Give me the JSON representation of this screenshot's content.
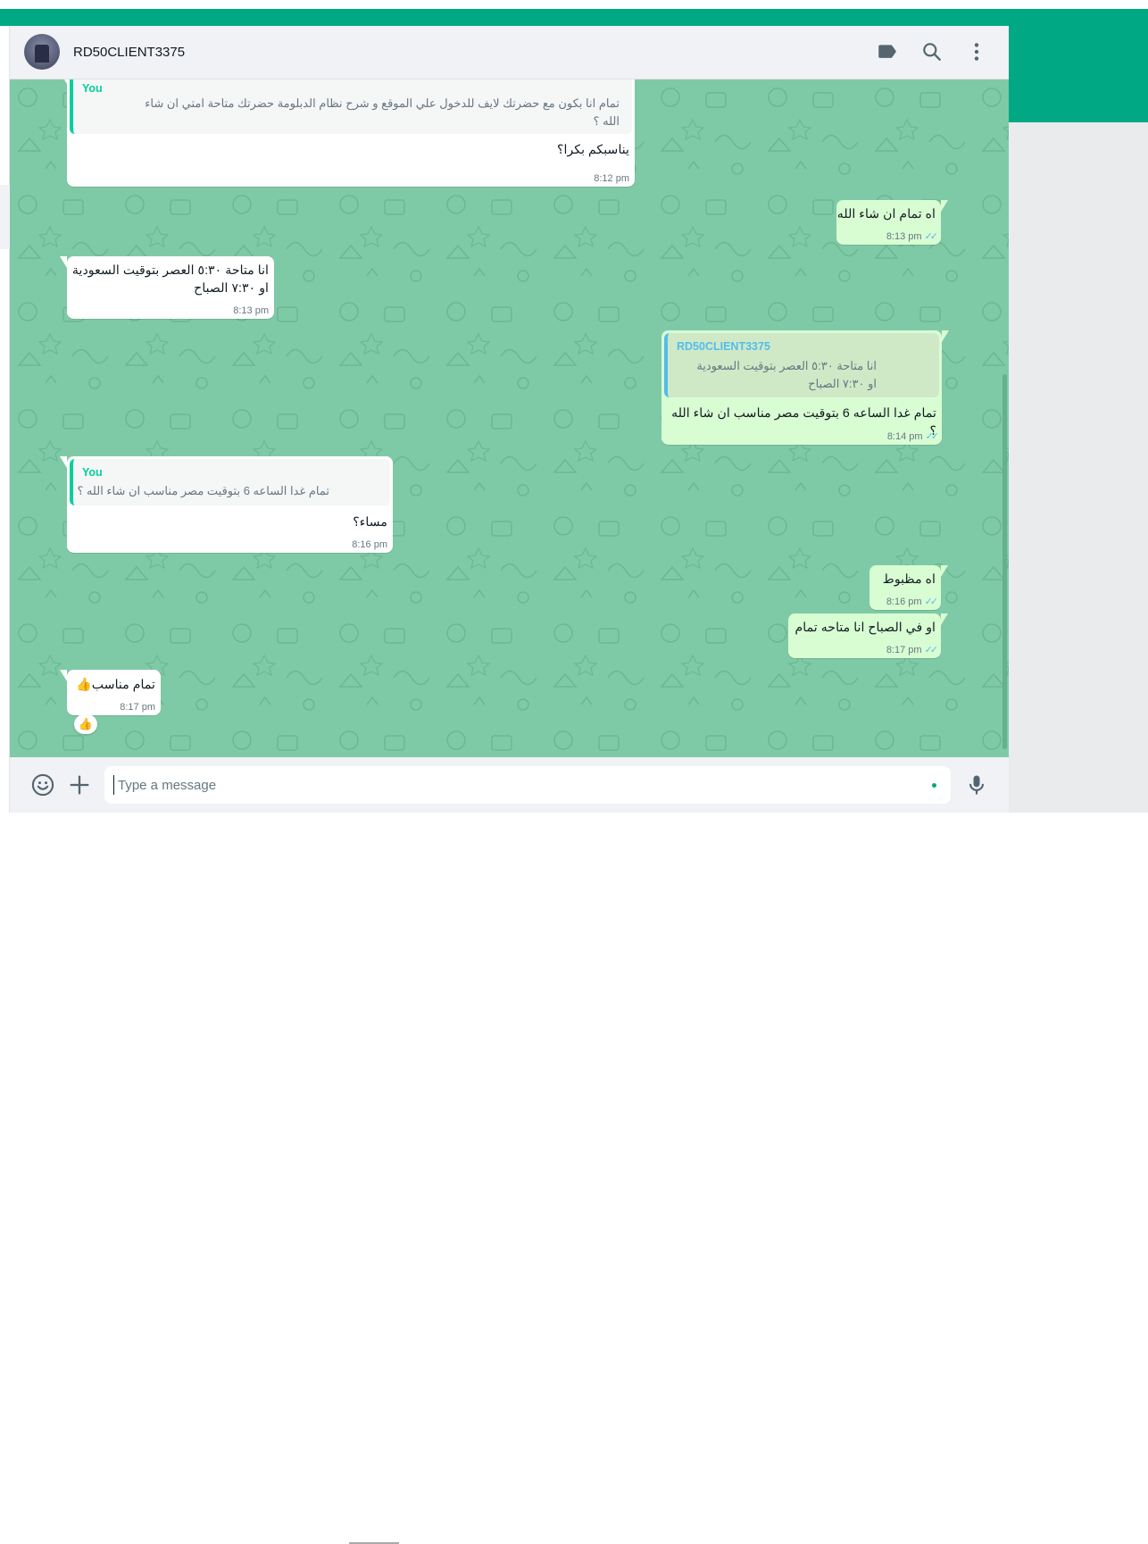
{
  "header": {
    "contact_name": "RD50CLIENT3375"
  },
  "messages": [
    {
      "direction": "in",
      "quote_author": "You",
      "quote_line1": "تمام انا بكون مع حضرتك لايف للدخول علي الموقع و شرح نظام الدبلومة حضرتك متاحة  امتي ان شاء",
      "quote_line2": "الله ؟",
      "text": "يناسبكم بكرا؟",
      "time": "8:12 pm"
    },
    {
      "direction": "out",
      "text": "اه تمام ان شاء الله",
      "time": "8:13 pm"
    },
    {
      "direction": "in",
      "text_line1": "انا متاحة ٥:٣٠ العصر بتوقيت السعودية",
      "text_line2": "او ٧:٣٠ الصباح",
      "time": "8:13 pm"
    },
    {
      "direction": "out",
      "quote_author": "RD50CLIENT3375",
      "quote_line1": "انا متاحة ٥:٣٠ العصر بتوقيت السعودية",
      "quote_line2": "او ٧:٣٠ الصباح",
      "text": "تمام غدا الساعه 6 بتوقيت مصر مناسب ان شاء الله ؟",
      "time": "8:14 pm"
    },
    {
      "direction": "in",
      "quote_author": "You",
      "quote_line1": "تمام غدا الساعه 6 بتوقيت مصر مناسب ان شاء الله ؟",
      "text": "مساء؟",
      "time": "8:16 pm"
    },
    {
      "direction": "out",
      "text": "اه مظبوط",
      "time": "8:16 pm"
    },
    {
      "direction": "out",
      "text": "او في الصباح انا متاحه تمام",
      "time": "8:17 pm"
    },
    {
      "direction": "in",
      "text": "تمام مناسب👍",
      "time": "8:17 pm",
      "reaction": "👍"
    }
  ],
  "composer": {
    "placeholder": "Type a message"
  },
  "icons": {
    "label": "label-icon",
    "search": "search-icon",
    "menu": "menu-icon",
    "emoji": "emoji-icon",
    "attach": "plus-icon",
    "mic": "mic-icon"
  },
  "colors": {
    "accent": "#00a884",
    "chat_background": "#7fcaa6",
    "outgoing_bubble": "#d9fdd3",
    "incoming_bubble": "#ffffff",
    "read_ticks": "#53bdeb"
  }
}
